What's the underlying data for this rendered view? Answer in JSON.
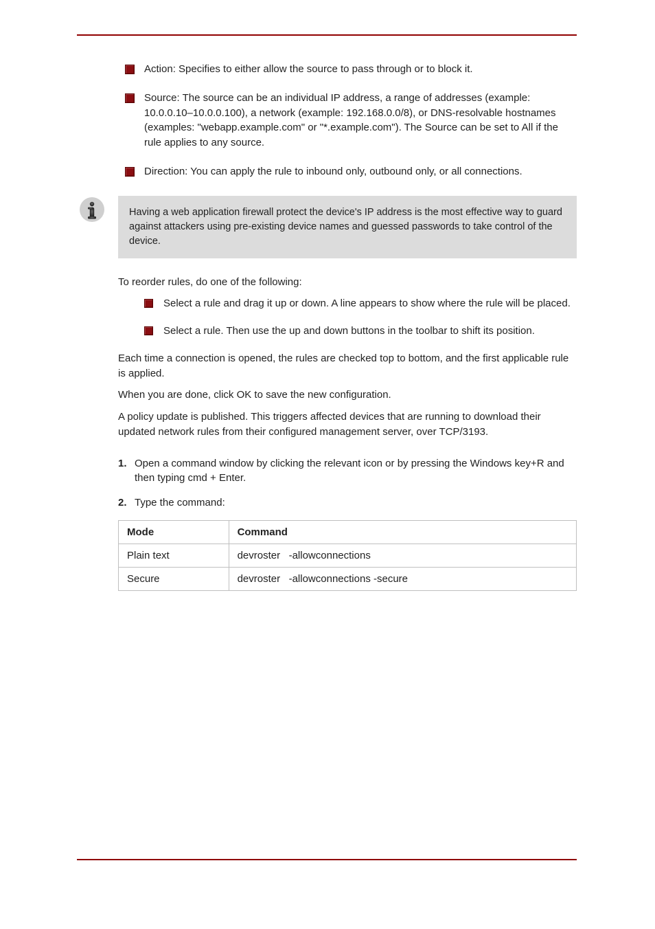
{
  "bulletsTop": [
    {
      "lead": "Action:",
      "text": " Specifies to either allow the source to pass through or to block it."
    },
    {
      "lead": "Source:",
      "text": " The source can be an individual IP address, a range of addresses (example: 10.0.0.10–10.0.0.100), a network (example: 192.168.0.0/8), or DNS-resolvable hostnames (examples: \"webapp.example.com\" or \"*.example.com\"). The Source can be set to All if the rule applies to any source."
    },
    {
      "lead": "Direction:",
      "text": " You can apply the rule to inbound only, outbound only, or all connections."
    }
  ],
  "note": "Having a web application firewall protect the device's IP address is the most effective way to guard against attackers using pre-existing device names and guessed passwords to take control of the device.",
  "reorderIntro": "To reorder rules, do one of the following:",
  "reorderBullets": [
    "Select a rule and drag it up or down. A line appears to show where the rule will be placed.",
    "Select a rule. Then use the up and down buttons in the toolbar to shift its position."
  ],
  "postList": [
    "Each time a connection is opened, the rules are checked top to bottom, and the first applicable rule is applied.",
    "When you are done, click OK to save the new configuration.",
    "A policy update is published. This triggers affected devices that are running to download their updated network rules from their configured management server, over TCP/3193."
  ],
  "steps": {
    "s1": "Open a command window by clicking the relevant icon or by pressing the Windows key+R and then typing cmd + Enter.",
    "s2": "Type the command:"
  },
  "table": {
    "headers": [
      "Mode",
      "Command"
    ],
    "rows": [
      [
        "Plain text",
        "devroster&nbsp;&nbsp;&nbsp;-allowconnections"
      ],
      [
        "Secure",
        "devroster&nbsp;&nbsp;&nbsp;-allowconnections -secure"
      ]
    ]
  }
}
